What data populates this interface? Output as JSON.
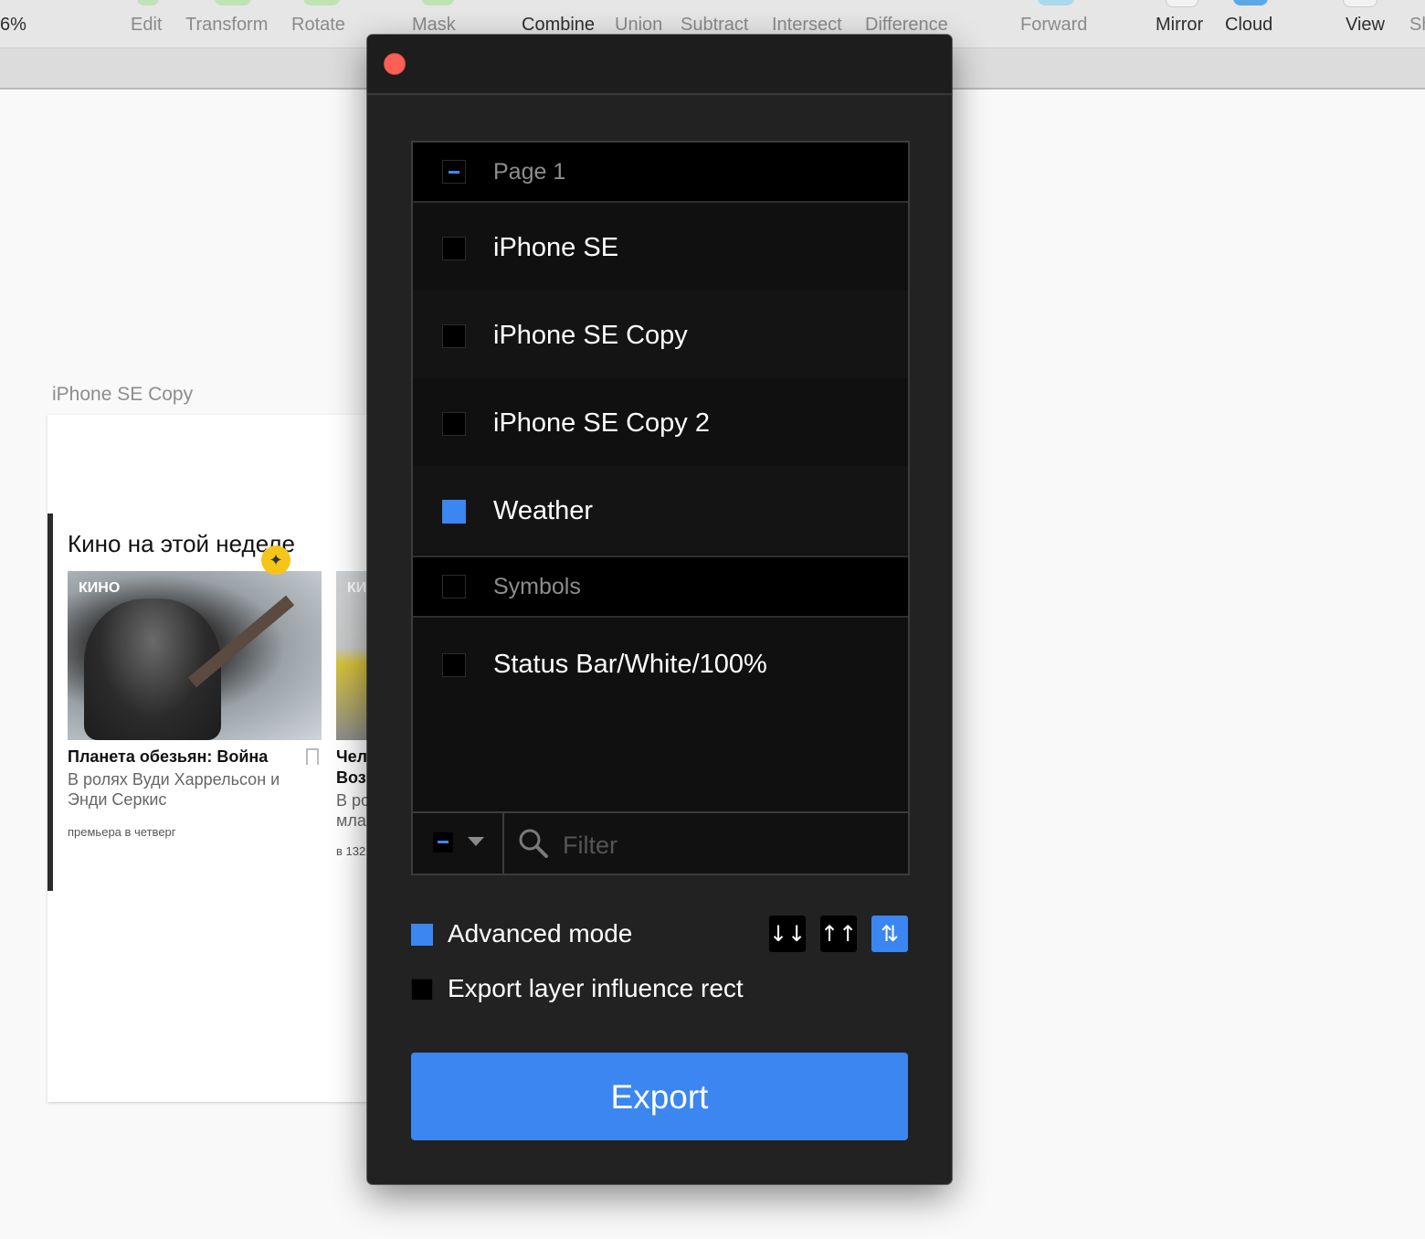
{
  "toolbar": {
    "zoom": "6%",
    "items": [
      "Edit",
      "Transform",
      "Rotate",
      "Mask",
      "Combine",
      "Union",
      "Subtract",
      "Intersect",
      "Difference",
      "Forward",
      "Mirror",
      "Cloud",
      "View",
      "Sh"
    ]
  },
  "canvas": {
    "artboard_label": "iPhone SE Copy",
    "section_title": "Кино на этой неделе",
    "card1": {
      "tag": "КИНО",
      "title": "Планета обезьян: Война",
      "subtitle": "В ролях Вуди Харрельсон и Энди Серкис",
      "meta": "премьера в четверг"
    },
    "card2": {
      "tag": "КИ",
      "title_line1": "Чел",
      "title_line2": "Воз",
      "sub_line1": "В ро",
      "sub_line2": "мла",
      "meta": "в 132"
    }
  },
  "dialog": {
    "layers": [
      {
        "label": "Page 1",
        "kind": "section",
        "state": "partial"
      },
      {
        "label": "iPhone SE",
        "kind": "item",
        "state": "unchecked"
      },
      {
        "label": "iPhone SE Copy",
        "kind": "item",
        "state": "unchecked"
      },
      {
        "label": "iPhone SE Copy 2",
        "kind": "item",
        "state": "unchecked"
      },
      {
        "label": "Weather",
        "kind": "item",
        "state": "checked"
      },
      {
        "label": "Symbols",
        "kind": "section",
        "state": "unchecked"
      },
      {
        "label": "Status Bar/White/100%",
        "kind": "item",
        "state": "unchecked"
      }
    ],
    "filter_placeholder": "Filter",
    "advanced_mode": {
      "label": "Advanced mode",
      "checked": true
    },
    "export_influence": {
      "label": "Export layer influence rect",
      "checked": false
    },
    "sort_buttons": [
      {
        "glyph": "↓↓",
        "icon": "sort-descending-icon",
        "active": false
      },
      {
        "glyph": "↑↑",
        "icon": "sort-ascending-icon",
        "active": false
      },
      {
        "glyph": "⇅",
        "icon": "sort-alphabetical-icon",
        "active": true
      }
    ],
    "export_label": "Export"
  },
  "colors": {
    "accent": "#3b86f0",
    "dialog_bg": "#222222",
    "list_bg": "#101010",
    "close": "#fe5f57"
  }
}
